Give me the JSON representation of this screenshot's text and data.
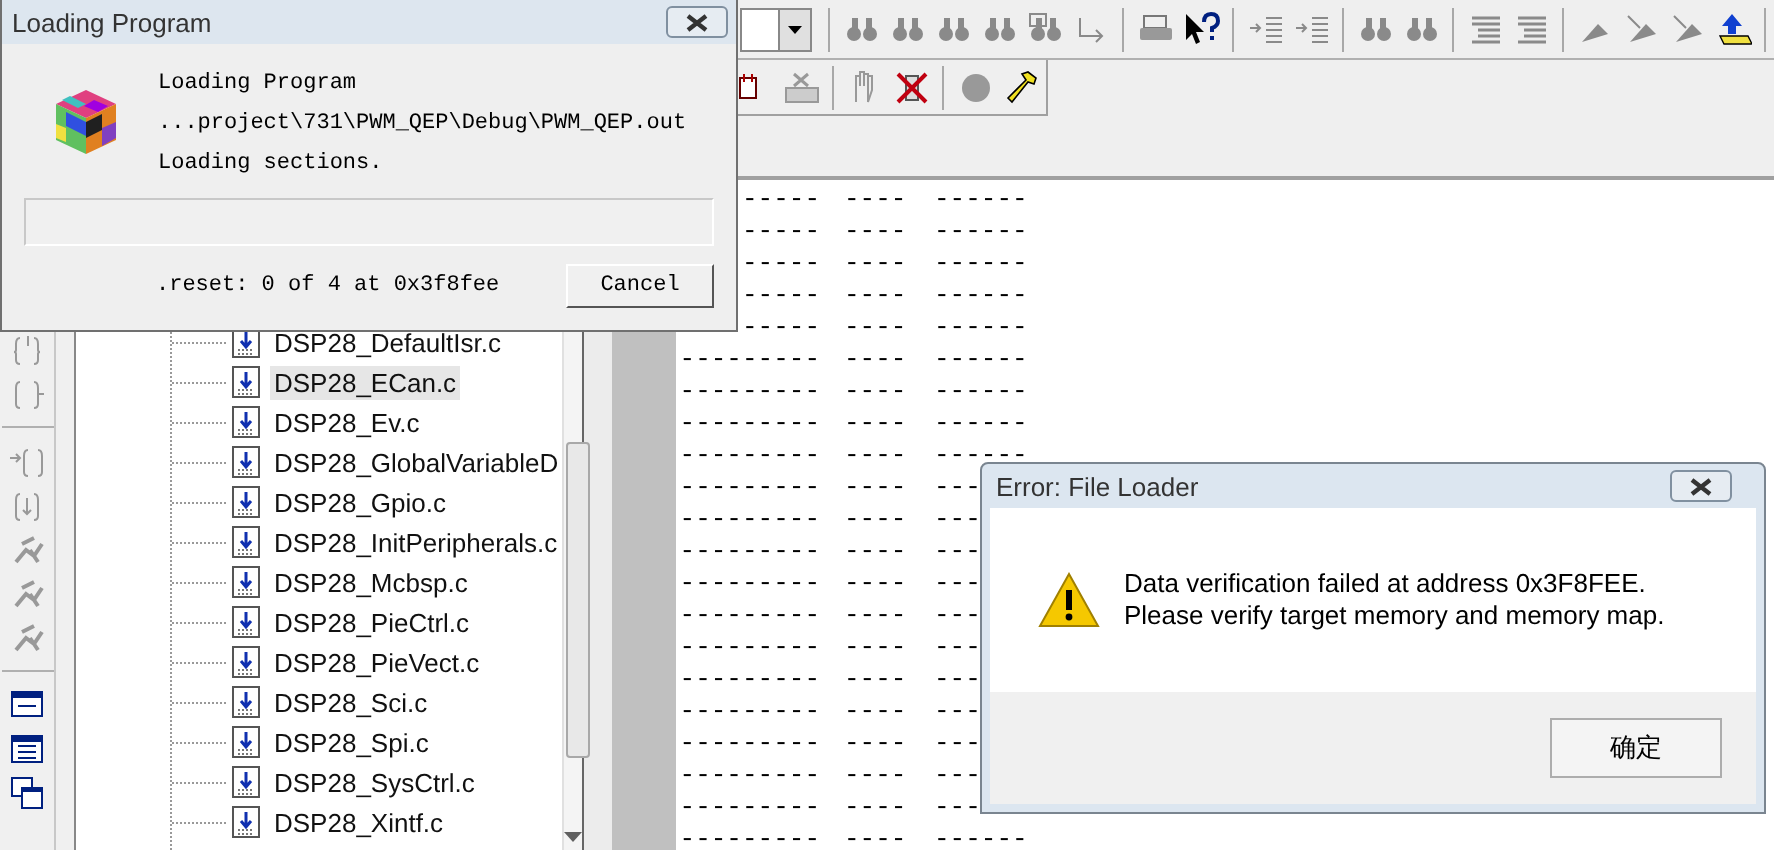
{
  "loading_dialog": {
    "title": "Loading Program",
    "heading": "Loading Program",
    "file_path": "...project\\731\\PWM_QEP\\Debug\\PWM_QEP.out",
    "status": "Loading sections.",
    "progress": {
      "level": 0
    },
    "section_status": ".reset: 0 of 4 at 0x3f8fee",
    "cancel_button": "Cancel"
  },
  "project_tree": {
    "items": [
      {
        "label": "DSP28_DefaultIsr.c",
        "selected": false
      },
      {
        "label": "DSP28_ECan.c",
        "selected": true
      },
      {
        "label": "DSP28_Ev.c",
        "selected": false
      },
      {
        "label": "DSP28_GlobalVariableD",
        "selected": false
      },
      {
        "label": "DSP28_Gpio.c",
        "selected": false
      },
      {
        "label": "DSP28_InitPeripherals.c",
        "selected": false
      },
      {
        "label": "DSP28_Mcbsp.c",
        "selected": false
      },
      {
        "label": "DSP28_PieCtrl.c",
        "selected": false
      },
      {
        "label": "DSP28_PieVect.c",
        "selected": false
      },
      {
        "label": "DSP28_Sci.c",
        "selected": false
      },
      {
        "label": "DSP28_Spi.c",
        "selected": false
      },
      {
        "label": "DSP28_SysCtrl.c",
        "selected": false
      },
      {
        "label": "DSP28_Xintf.c",
        "selected": false
      }
    ]
  },
  "memory_view": {
    "rows": [
      [
        "-----",
        "----",
        "------"
      ],
      [
        "-----",
        "----",
        "------"
      ],
      [
        "-----",
        "----",
        "------"
      ],
      [
        "-----",
        "----",
        "------"
      ],
      [
        "-----",
        "----",
        "------"
      ],
      [
        "---------",
        "----",
        "------"
      ],
      [
        "---------",
        "----",
        "------"
      ],
      [
        "---------",
        "----",
        "------"
      ],
      [
        "---------",
        "----",
        "------"
      ],
      [
        "---------",
        "----",
        "---"
      ],
      [
        "---------",
        "----",
        "---"
      ],
      [
        "---------",
        "----",
        "---"
      ],
      [
        "---------",
        "----",
        "---"
      ],
      [
        "---------",
        "----",
        "---"
      ],
      [
        "---------",
        "----",
        "---"
      ],
      [
        "---------",
        "----",
        "---"
      ],
      [
        "---------",
        "----",
        "---"
      ],
      [
        "---------",
        "----",
        "---"
      ],
      [
        "---------",
        "----",
        "---"
      ],
      [
        "---------",
        "----",
        "---"
      ],
      [
        "---------",
        "----",
        "------"
      ]
    ]
  },
  "error_dialog": {
    "title": "Error: File Loader",
    "message_lines": [
      "Data verification failed at address 0x3F8FEE.",
      "Please verify target memory and memory map."
    ],
    "ok_button": "确定"
  }
}
